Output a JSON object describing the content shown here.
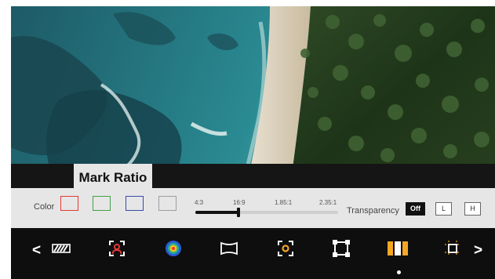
{
  "panel": {
    "title": "Mark Ratio",
    "color_label": "Color",
    "swatches": [
      {
        "name": "red",
        "color": "#e53935"
      },
      {
        "name": "green",
        "color": "#43a047"
      },
      {
        "name": "blue",
        "color": "#3949ab"
      },
      {
        "name": "gray",
        "color": "#9e9e9e"
      }
    ],
    "ratio_labels": [
      "4:3",
      "16:9",
      "1.85:1",
      "2.35:1"
    ],
    "selected_ratio": "16:9",
    "slider_value": 0.3,
    "transparency_label": "Transparency",
    "transparency_options": [
      "Off",
      "L",
      "H"
    ],
    "transparency_selected": "Off"
  },
  "toolbar": {
    "prev_label": "<",
    "next_label": ">",
    "tools": [
      "zebra-icon",
      "focus-assist-icon",
      "false-color-icon",
      "anamorphic-icon",
      "center-marker-icon",
      "safe-frame-icon",
      "mark-ratio-icon",
      "grid-marker-icon"
    ],
    "active_tool": "mark-ratio-icon",
    "active_color": "#f5a623"
  }
}
